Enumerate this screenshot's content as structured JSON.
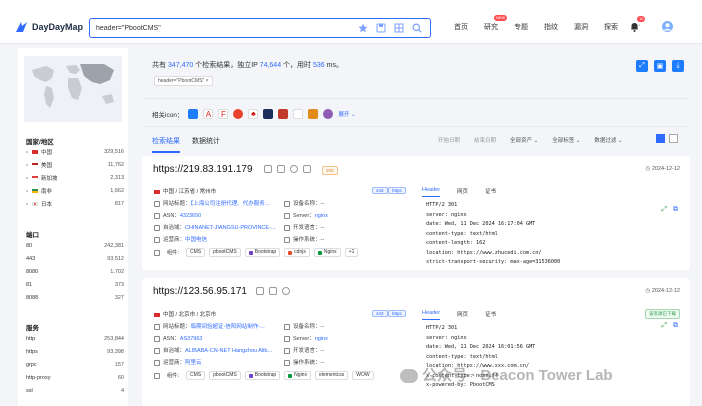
{
  "logo": {
    "text": "DayDayMap"
  },
  "search": {
    "value": "header=\"PbootCMS\""
  },
  "nav": [
    {
      "label": "首页"
    },
    {
      "label": "研究",
      "badge": "NEW"
    },
    {
      "label": "专题"
    },
    {
      "label": "指纹"
    },
    {
      "label": "漏洞"
    },
    {
      "label": "探索"
    },
    {
      "label": "···"
    }
  ],
  "notification_count": "10",
  "summary": {
    "prefix": "共有",
    "total": "347,470",
    "mid": "个检索结果，独立IP",
    "ips": "74,644",
    "mid2": "个，用时",
    "time": "536",
    "suffix": "ms。"
  },
  "query_tag": "header=\"PbootCMS\"",
  "related": {
    "label": "相关icon：",
    "expand": "展开"
  },
  "tabs": {
    "results": "检索结果",
    "stats": "数据统计"
  },
  "filters": [
    "开始日期",
    "结束日期",
    "全部资产",
    "全部标签",
    "数据过滤"
  ],
  "sidebar": {
    "country_title": "国家/地区",
    "countries": [
      {
        "name": "中国",
        "count": "329,516",
        "color": "#d92b2b"
      },
      {
        "name": "美国",
        "count": "11,762",
        "color": "#3a5bb0"
      },
      {
        "name": "新加坡",
        "count": "2,313",
        "color": "#e23b3b"
      },
      {
        "name": "南非",
        "count": "1,662",
        "color": "#2e8b57"
      },
      {
        "name": "日本",
        "count": "817",
        "color": "#ffffff"
      }
    ],
    "port_title": "端口",
    "ports": [
      {
        "name": "80",
        "count": "242,381"
      },
      {
        "name": "443",
        "count": "93,512"
      },
      {
        "name": "8080",
        "count": "1,702"
      },
      {
        "name": "81",
        "count": "373"
      },
      {
        "name": "8088",
        "count": "327"
      }
    ],
    "service_title": "服务",
    "services": [
      {
        "name": "http",
        "count": "253,844"
      },
      {
        "name": "https",
        "count": "93,398"
      },
      {
        "name": "grpc",
        "count": "157"
      },
      {
        "name": "http-proxy",
        "count": "60"
      },
      {
        "name": "ssl",
        "count": "4"
      }
    ]
  },
  "cards": [
    {
      "url": "https://219.83.191.179",
      "tag": "200",
      "date": "2024-12-12",
      "location": "中国 / 江苏省 / 常州市",
      "title_label": "网站标题：",
      "title_value": "【上海公司注册代理、代办服务...",
      "asn_label": "ASN：",
      "asn_value": "4323650",
      "org_label": "自治域：",
      "org_value": "CHINANET-JIANGSU-PROVINCE-...",
      "isp_label": "运营商：",
      "isp_value": "中国电信",
      "device_label": "设备名称：",
      "device_value": "--",
      "server_label": "Server：",
      "server_value": "nginx",
      "dev_label": "开发语言：",
      "dev_value": "--",
      "os_label": "操作系统：",
      "os_value": "--",
      "badges": [
        "443",
        "https"
      ],
      "components_label": "组件：",
      "components": [
        "CMS",
        "pbootCMS",
        "Bootstrap",
        "cdnjs",
        "Nginx",
        "+1"
      ],
      "resp_tabs": [
        "Header",
        "网页",
        "证书"
      ],
      "response": "HTTP/2 301\nserver: nginx\ndate: Wed, 11 Dec 2024 16:17:04 GMT\ncontent-type: text/html\ncontent-length: 162\nlocation: https://www.zhucedi.com.cn/\nstrict-transport-security: max-age=31536000"
    },
    {
      "url": "https://123.56.95.171",
      "date": "2024-12-12",
      "location": "中国 / 北京市 / 北京市",
      "title_label": "网站标题：",
      "title_value": "临期间验超证-信阳网站制作-...",
      "asn_label": "ASN：",
      "asn_value": "AS37963",
      "org_label": "自治域：",
      "org_value": "ALIBABA-CN-NET Hangzhou Alib...",
      "isp_label": "运营商：",
      "isp_value": "阿里云",
      "device_label": "设备名称：",
      "device_value": "--",
      "server_label": "Server：",
      "server_value": "nginx",
      "dev_label": "开发语言：",
      "dev_value": "--",
      "os_label": "操作系统：",
      "os_value": "--",
      "badges": [
        "443",
        "https"
      ],
      "components_label": "组件：",
      "components": [
        "CMS",
        "pbootCMS",
        "Bootstrap",
        "Nginx",
        "elementcss",
        "WOW"
      ],
      "resp_tabs": [
        "Header",
        "网页",
        "证书"
      ],
      "green_tag": "该资源已下载",
      "response": "HTTP/2 301\nserver: nginx\ndate: Wed, 11 Dec 2024 16:01:56 GMT\ncontent-type: text/html\nlocation: https://www.xxx.com.cn/\nx-content-type: nosniff\nx-powered-by: PbootCMS"
    }
  ],
  "watermark": "公众号 · Beacon Tower Lab"
}
